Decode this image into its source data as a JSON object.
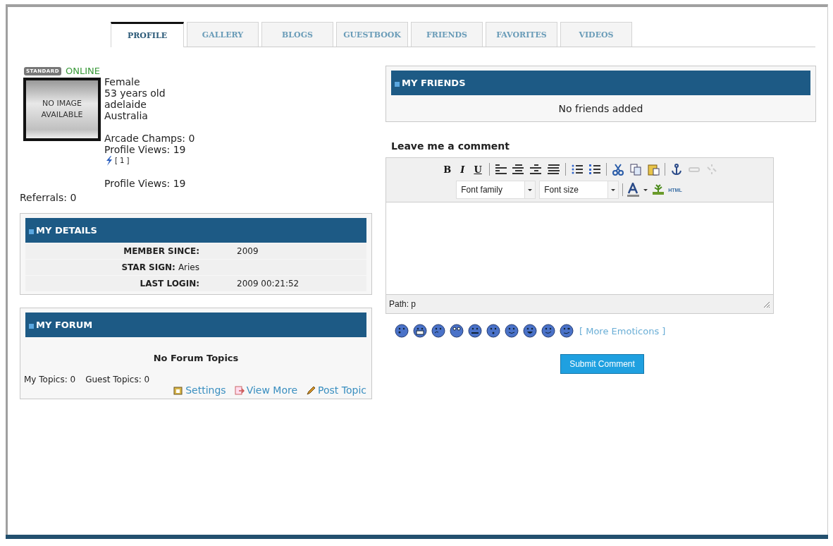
{
  "tabs": [
    {
      "label": "PROFILE",
      "selected": true
    },
    {
      "label": "GALLERY",
      "selected": false
    },
    {
      "label": "BLOGS",
      "selected": false
    },
    {
      "label": "GUESTBOOK",
      "selected": false
    },
    {
      "label": "FRIENDS",
      "selected": false
    },
    {
      "label": "FAVORITES",
      "selected": false
    },
    {
      "label": "VIDEOS",
      "selected": false
    }
  ],
  "profile": {
    "badge": "STANDARD",
    "status": "ONLINE",
    "photo_text": "NO IMAGE AVAILABLE",
    "facts": [
      "Female",
      "53 years old",
      "adelaide",
      "Australia"
    ],
    "stats": [
      "Arcade Champs: 0",
      "Profile Views: 19"
    ],
    "rating_count": "[ 1 ]",
    "views_again": "Profile Views: 19",
    "referrals": "Referrals: 0"
  },
  "details": {
    "title": "MY DETAILS",
    "rows": [
      {
        "label": "MEMBER SINCE:",
        "value": "2009",
        "kind": "column"
      },
      {
        "label": "STAR SIGN:",
        "value": "Aries",
        "kind": "inline"
      },
      {
        "label": "LAST LOGIN:",
        "value": "2009 00:21:52",
        "kind": "column"
      }
    ]
  },
  "forum": {
    "title": "MY FORUM",
    "empty": "No Forum Topics",
    "counts": [
      "My Topics: 0",
      "Guest Topics: 0"
    ],
    "links": [
      "Settings",
      "View More",
      "Post Topic"
    ]
  },
  "friends": {
    "title": "MY FRIENDS",
    "empty": "No friends added"
  },
  "comment": {
    "heading": "Leave me a comment",
    "format_buttons": [
      "B",
      "I",
      "U"
    ],
    "font_family": "Font family",
    "font_size": "Font size",
    "html_button": "HTML",
    "path": "Path: p",
    "more_emoticons": "[ More Emoticons ]",
    "submit": "Submit Comment"
  }
}
